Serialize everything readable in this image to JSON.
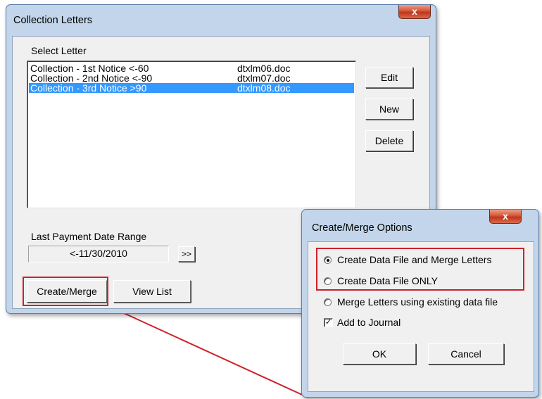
{
  "main_dialog": {
    "title": "Collection Letters",
    "close_glyph": "x",
    "select_letter_label": "Select Letter",
    "letters": [
      {
        "name": "Collection - 1st Notice <-60",
        "file": "dtxlm06.doc",
        "selected": false
      },
      {
        "name": "Collection - 2nd Notice <-90",
        "file": "dtxlm07.doc",
        "selected": false
      },
      {
        "name": "Collection - 3rd Notice >90",
        "file": "dtxlm08.doc",
        "selected": true
      }
    ],
    "edit_label": "Edit",
    "new_label": "New",
    "delete_label": "Delete",
    "date_range_label": "Last Payment Date Range",
    "date_range_value": "<-11/30/2010",
    "date_range_button": ">>",
    "create_merge_label": "Create/Merge",
    "view_list_label": "View List"
  },
  "options_dialog": {
    "title": "Create/Merge Options",
    "close_glyph": "x",
    "options": [
      {
        "label": "Create Data File and Merge Letters",
        "checked": true
      },
      {
        "label": "Create Data File ONLY",
        "checked": false
      },
      {
        "label": "Merge Letters using existing data file",
        "checked": false
      }
    ],
    "add_to_journal_label": "Add to Journal",
    "add_to_journal_checked": true,
    "ok_label": "OK",
    "cancel_label": "Cancel"
  },
  "colors": {
    "highlight": "#d0202a",
    "selection": "#3399ff",
    "frame": "#c2d5ea"
  }
}
